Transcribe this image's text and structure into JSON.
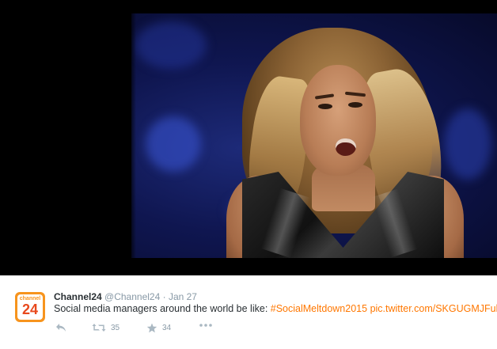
{
  "tweet": {
    "display_name": "Channel24",
    "handle": "@Channel24",
    "separator": "·",
    "timestamp": "Jan 27",
    "text_prefix": "Social media managers around the world be like: ",
    "hashtag": "#SocialMeltdown2015",
    "link": "pic.twitter.com/SKGUGMJFul",
    "avatar": {
      "word": "channel",
      "number": "24",
      "color": "#f7941d"
    },
    "retweet_count": "35",
    "favorite_count": "34",
    "link_color": "#ff7700"
  },
  "icons": {
    "reply": "reply-icon",
    "retweet": "retweet-icon",
    "favorite": "star-icon",
    "more": "more-icon"
  }
}
